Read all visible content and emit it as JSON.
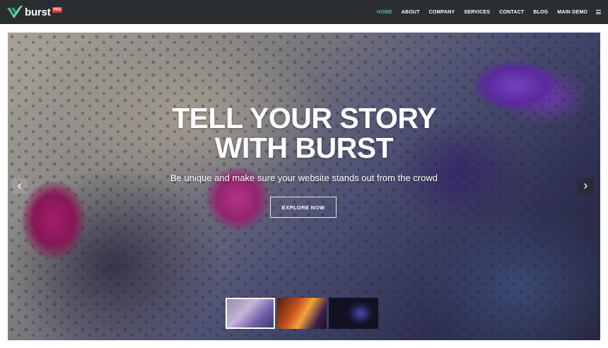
{
  "brand": {
    "name": "burst",
    "badge": "PRO",
    "accent_color": "#4fc08d",
    "nav_bg": "#2a2e31"
  },
  "nav": {
    "items": [
      {
        "label": "HOME",
        "active": true
      },
      {
        "label": "ABOUT",
        "active": false
      },
      {
        "label": "COMPANY",
        "active": false
      },
      {
        "label": "SERVICES",
        "active": false
      },
      {
        "label": "CONTACT",
        "active": false
      },
      {
        "label": "BLOG",
        "active": false
      },
      {
        "label": "MAIN DEMO",
        "active": false
      }
    ],
    "menu_icon": "hamburger-icon"
  },
  "hero": {
    "title_line1": "TELL YOUR STORY",
    "title_line2": "WITH BURST",
    "subtitle": "Be unique and make sure your website stands out from the crowd",
    "cta_label": "EXPLORE NOW",
    "prev_icon": "chevron-left-icon",
    "next_icon": "chevron-right-icon",
    "thumbnails": [
      {
        "active": true
      },
      {
        "active": false
      },
      {
        "active": false
      }
    ]
  }
}
